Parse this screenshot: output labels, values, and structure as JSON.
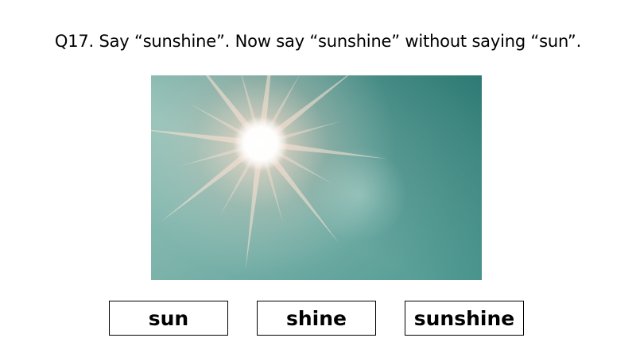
{
  "question": {
    "text": "Q17. Say “sunshine”. Now say “sunshine” without saying “sun”."
  },
  "image": {
    "subject": "sun-in-sky",
    "colors": {
      "sky_light": "#8dbdb4",
      "sky_dark": "#2f7f78",
      "sun_core": "#ffffff",
      "ray": "#ffd9c4"
    }
  },
  "choices": [
    {
      "label": "sun"
    },
    {
      "label": "shine"
    },
    {
      "label": "sunshine"
    }
  ]
}
